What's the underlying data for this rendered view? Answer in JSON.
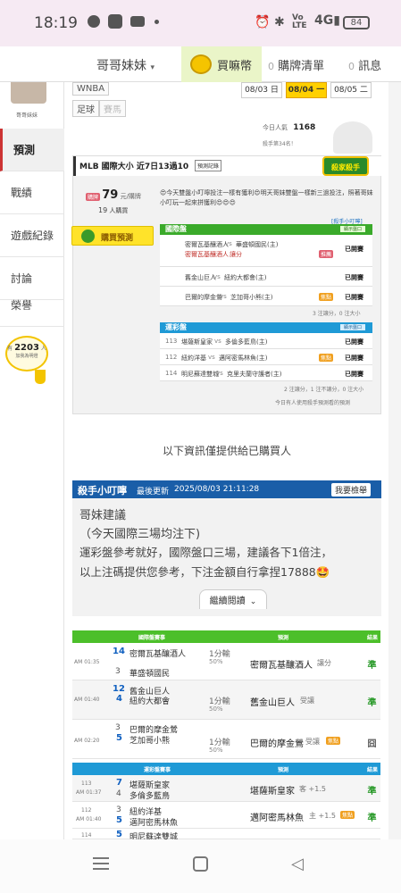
{
  "status": {
    "time": "18:19",
    "battery": "84"
  },
  "topnav": {
    "user": "哥哥妹妹",
    "buy_coin": "買嘛幣",
    "list_count": "0",
    "list_label": "購牌清單",
    "msg_count": "0",
    "msg_label": "訊息"
  },
  "sidebar": {
    "avatar_name": "哥哥妹妹",
    "items": [
      "預測",
      "戰績",
      "遊戲紀錄",
      "討論",
      "榮譽"
    ],
    "fans_prefix": "有",
    "fans_count": "2203",
    "fans_suffix": "人",
    "fans_line2": "加我為明燈"
  },
  "filters": {
    "tags": [
      "WNBA",
      "足球",
      "賽馬"
    ],
    "dates": [
      {
        "date": "08/03",
        "day": "日"
      },
      {
        "date": "08/04",
        "day": "一"
      },
      {
        "date": "08/05",
        "day": "二"
      }
    ]
  },
  "stats": {
    "today_label": "今日人氣",
    "today_value": "1168",
    "rank_text": "殺手第34名！"
  },
  "card": {
    "title": "MLB 國際大小 近7日13過10",
    "record_btn": "預測記錄",
    "killer_badge": "殺家殺手",
    "price": "79",
    "price_unit": "元/購牌",
    "buyers": "19",
    "buyers_unit": "人購買",
    "buy_btn": "購買預測",
    "intro": "😍今天雙盤小叮嚀投注一樣有獲利😍明天哥妹雙盤一樣新三過投注，照著哥妹小叮玩一起來拼獲利😍😍😍",
    "tip_link": "[殺手小叮嚀]",
    "intl_header": "國際盤",
    "intl_btn": "顯示盤口",
    "intl_rows": [
      {
        "team1": "密爾瓦基釀酒人",
        "team2": "華盛頓國民(主)",
        "pick": "密爾瓦基釀酒人",
        "note": "讓分",
        "status": "已開賽"
      },
      {
        "team1": "舊金山巨人",
        "team2": "紐約大都會(主)",
        "pick": "",
        "note": "",
        "status": "已開賽"
      },
      {
        "team1": "巴爾的摩金鶯",
        "team2": "芝加哥小熊(主)",
        "pick": "",
        "note": "",
        "status": "已開賽"
      }
    ],
    "intl_summary": "3 注讓分，0 注大小",
    "lottery_header": "運彩盤",
    "lottery_btn": "顯示盤口",
    "lottery_rows": [
      {
        "num": "113",
        "team1": "堪薩斯皇家",
        "team2": "多倫多藍鳥(主)",
        "status": "已開賽"
      },
      {
        "num": "112",
        "team1": "紐約洋基",
        "team2": "邁阿密馬林魚(主)",
        "status": "已開賽"
      },
      {
        "num": "114",
        "team1": "明尼蘇達雙城",
        "team2": "克里夫蘭守護者(主)",
        "status": "已開賽"
      }
    ],
    "lottery_summary": "2 注讓分，1 注不讓分，0 注大小",
    "footnote": "今日有人使用殺手預測看的預測"
  },
  "purchased_notice": "以下資訊僅提供給已購買人",
  "tip": {
    "title": "殺手小叮嚀",
    "updated_label": "最後更新",
    "updated": "2025/08/03 21:11:28",
    "check_btn": "我要檢舉",
    "line1": "哥妹建議",
    "line2": "（今天國際三場均注下)",
    "line3": "運彩盤參考就好，國際盤口三場，建議各下1倍注，",
    "line4": "以上注碼提供您參考，下注金額自行拿捏17888🤩",
    "read_more": "繼續閱讀"
  },
  "intl_table": {
    "header_game": "國際盤賽事",
    "header_pick": "預測",
    "header_res": "結果",
    "rows": [
      {
        "time": "AM 01:35",
        "n1": "14",
        "t1": "密爾瓦基釀酒人",
        "n2": "3",
        "t2": "華盛頓國民",
        "line": "1分輸",
        "line2": "50%",
        "pick": "密爾瓦基釀酒人",
        "note": "讓分",
        "result": "準"
      },
      {
        "time": "AM 01:40",
        "n1": "12",
        "t1": "舊金山巨人",
        "n2": "4",
        "t2": "紐約大都會",
        "line": "1分輸",
        "line2": "50%",
        "pick": "舊金山巨人",
        "note": "受讓",
        "result": "準"
      },
      {
        "time": "AM 02:20",
        "n1": "3",
        "t1": "巴爾的摩金鶯",
        "n2": "5",
        "t2": "芝加哥小熊",
        "line": "1分輸",
        "line2": "50%",
        "pick": "巴爾的摩金鶯",
        "note": "受讓",
        "result": "囧"
      }
    ]
  },
  "lottery_table": {
    "header_game": "運彩盤賽事",
    "header_pick": "預測",
    "header_res": "結果",
    "rows": [
      {
        "num": "113",
        "time": "AM 01:37",
        "n1": "7",
        "t1": "堪薩斯皇家",
        "n2": "4",
        "t2": "多倫多藍鳥",
        "pick": "堪薩斯皇家",
        "note": "客 +1.5",
        "result": "準"
      },
      {
        "num": "112",
        "time": "AM 01:40",
        "n1": "3",
        "t1": "紐約洋基",
        "n2": "5",
        "t2": "邁阿密馬林魚",
        "pick": "邁阿密馬林魚",
        "note": "主 +1.5",
        "result": "準"
      },
      {
        "num": "114",
        "time": "",
        "n1": "5",
        "t1": "明尼蘇達雙城",
        "n2": "",
        "t2": "",
        "pick": "",
        "note": "",
        "result": ""
      }
    ]
  }
}
